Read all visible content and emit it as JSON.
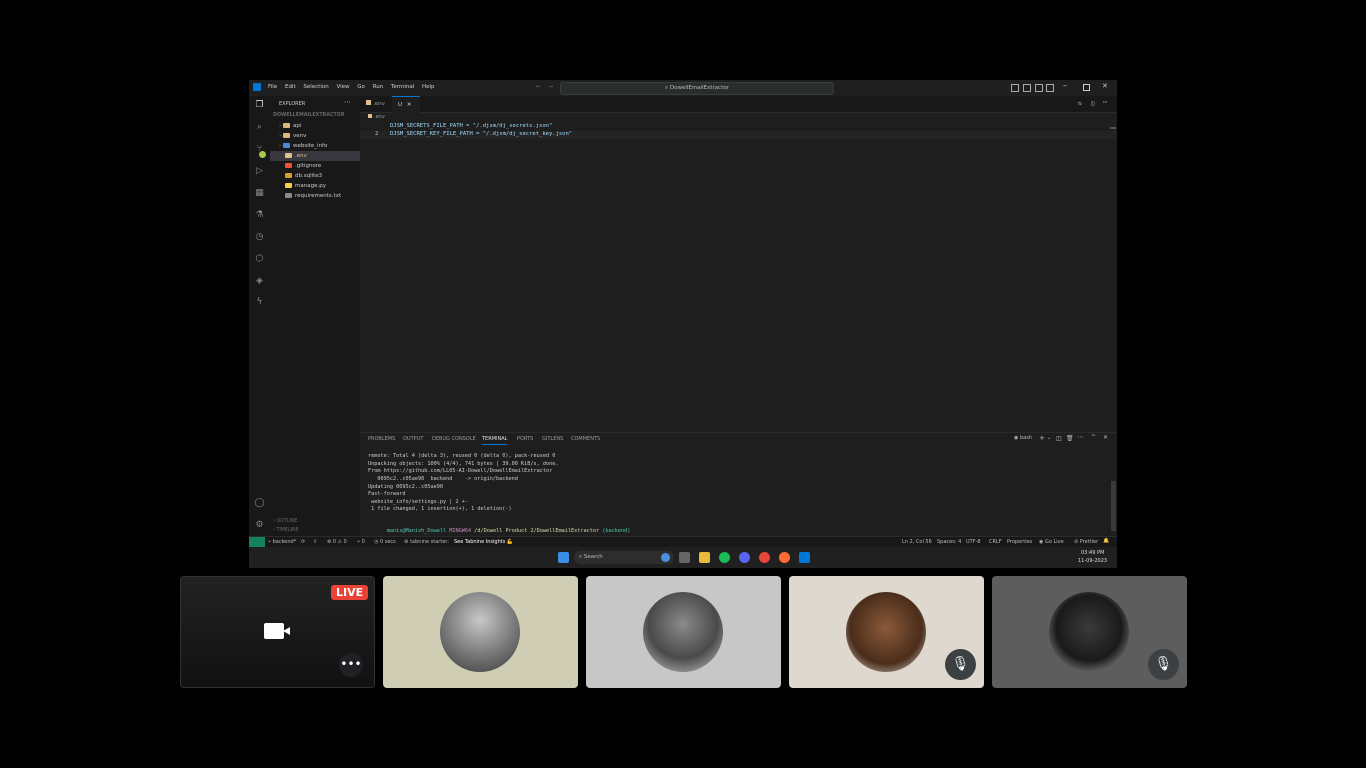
{
  "window": {
    "menu": [
      "File",
      "Edit",
      "Selection",
      "View",
      "Go",
      "Run",
      "Terminal",
      "Help"
    ],
    "search": "DowellEmailExtractor"
  },
  "sidebar": {
    "title": "EXPLORER",
    "project": "DOWELLEMAILEXTRACTOR",
    "items": [
      {
        "label": "api",
        "type": "folder"
      },
      {
        "label": "venv",
        "type": "folder"
      },
      {
        "label": "website_info",
        "type": "folder"
      },
      {
        "label": ".env",
        "type": "file",
        "badge": "U"
      },
      {
        "label": ".gitignore",
        "type": "file"
      },
      {
        "label": "db.sqlite3",
        "type": "file"
      },
      {
        "label": "manage.py",
        "type": "file"
      },
      {
        "label": "requirements.txt",
        "type": "file"
      }
    ],
    "outline": "OUTLINE",
    "timeline": "TIMELINE"
  },
  "editor": {
    "tabs": [
      ".env",
      "U"
    ],
    "breadcrumb": ".env",
    "lines": [
      {
        "num": "",
        "text": "DJSM_SECRETS_FILE_PATH = \"/.djsm/dj_secrets.json\""
      },
      {
        "num": "2",
        "text": "DJSM_SECRET_KEY_FILE_PATH = \"/.djsm/dj_secret_key.json\""
      }
    ]
  },
  "panel": {
    "tabs": [
      "PROBLEMS",
      "OUTPUT",
      "DEBUG CONSOLE",
      "TERMINAL",
      "PORTS",
      "GITLENS",
      "COMMENTS"
    ],
    "shell": "bash",
    "terminal": [
      "remote: Total 4 (delta 3), reused 0 (delta 0), pack-reused 0",
      "Unpacking objects: 100% (4/4), 741 bytes | 39.00 KiB/s, done.",
      "From https://github.com/LL05-AI-Dowell/DowellEmailExtractor",
      "   0095c2..c05ae90  backend    -> origin/backend",
      "Updating 0095c2..c05ae90",
      "Fast-forward",
      " website_info/settings.py | 2 +-",
      " 1 file changed, 1 insertion(+), 1 deletion(-)"
    ],
    "prompt": {
      "user": "manis@Manish_Dowell",
      "env": "MINGW64",
      "path": "/d/Dowell Product 2/DowellEmailExtractor",
      "branch": "(backend)"
    },
    "cursor": "$"
  },
  "statusbar": {
    "branch": "backend*",
    "problems": "⊗ 0 ⚠ 0",
    "ports": "0",
    "time": "0 secs",
    "tabnine": "tabnine starter:",
    "insights": "See Tabnine Insights",
    "position": "Ln 2, Col 56",
    "spaces": "Spaces: 4",
    "encoding": "UTF-8",
    "eol": "CRLF",
    "properties": "Properties",
    "golive": "Go Live",
    "prettier": "Prettier"
  },
  "taskbar": {
    "search": "Search",
    "time": "03:49 PM",
    "date": "11-09-2023"
  },
  "meeting": {
    "live_label": "LIVE"
  },
  "colors": {
    "accent": "#0078d4",
    "terminal_green": "#4ec9b0",
    "prompt_purple": "#c586c0",
    "prompt_yellow": "#dcdcaa",
    "string_orange": "#ce9178"
  }
}
